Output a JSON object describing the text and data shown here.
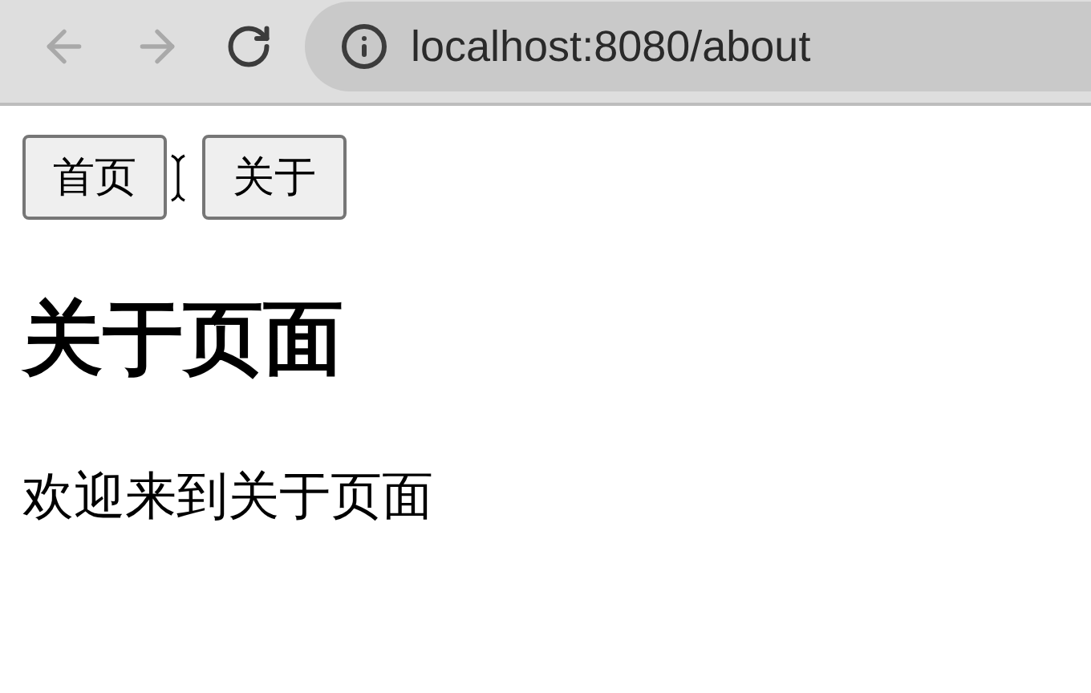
{
  "toolbar": {
    "back": {
      "disabled": true
    },
    "forward": {
      "disabled": true
    },
    "address": "localhost:8080/about"
  },
  "nav_buttons": [
    {
      "label": "首页"
    },
    {
      "label": "关于"
    }
  ],
  "heading": "关于页面",
  "paragraph": "欢迎来到关于页面"
}
